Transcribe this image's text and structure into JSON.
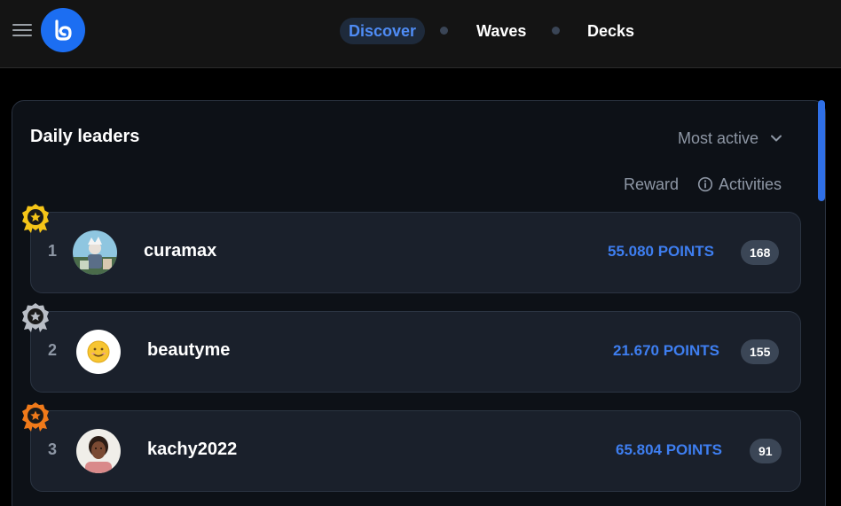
{
  "header": {
    "nav": [
      {
        "label": "Discover",
        "active": true
      },
      {
        "label": "Waves",
        "active": false
      },
      {
        "label": "Decks",
        "active": false
      }
    ]
  },
  "leaderboard": {
    "title": "Daily leaders",
    "sort": {
      "selected": "Most active"
    },
    "columns": {
      "reward": "Reward",
      "activities": "Activities"
    },
    "rows": [
      {
        "rank": "1",
        "username": "curamax",
        "points": "55.080 POINTS",
        "activities": "168",
        "medal": "gold"
      },
      {
        "rank": "2",
        "username": "beautyme",
        "points": "21.670 POINTS",
        "activities": "155",
        "medal": "silver"
      },
      {
        "rank": "3",
        "username": "kachy2022",
        "points": "65.804 POINTS",
        "activities": "91",
        "medal": "bronze"
      }
    ]
  },
  "colors": {
    "accent": "#3e7ef0",
    "gold": "#f5c518",
    "silver": "#b9bec6",
    "bronze": "#f07a1a"
  }
}
